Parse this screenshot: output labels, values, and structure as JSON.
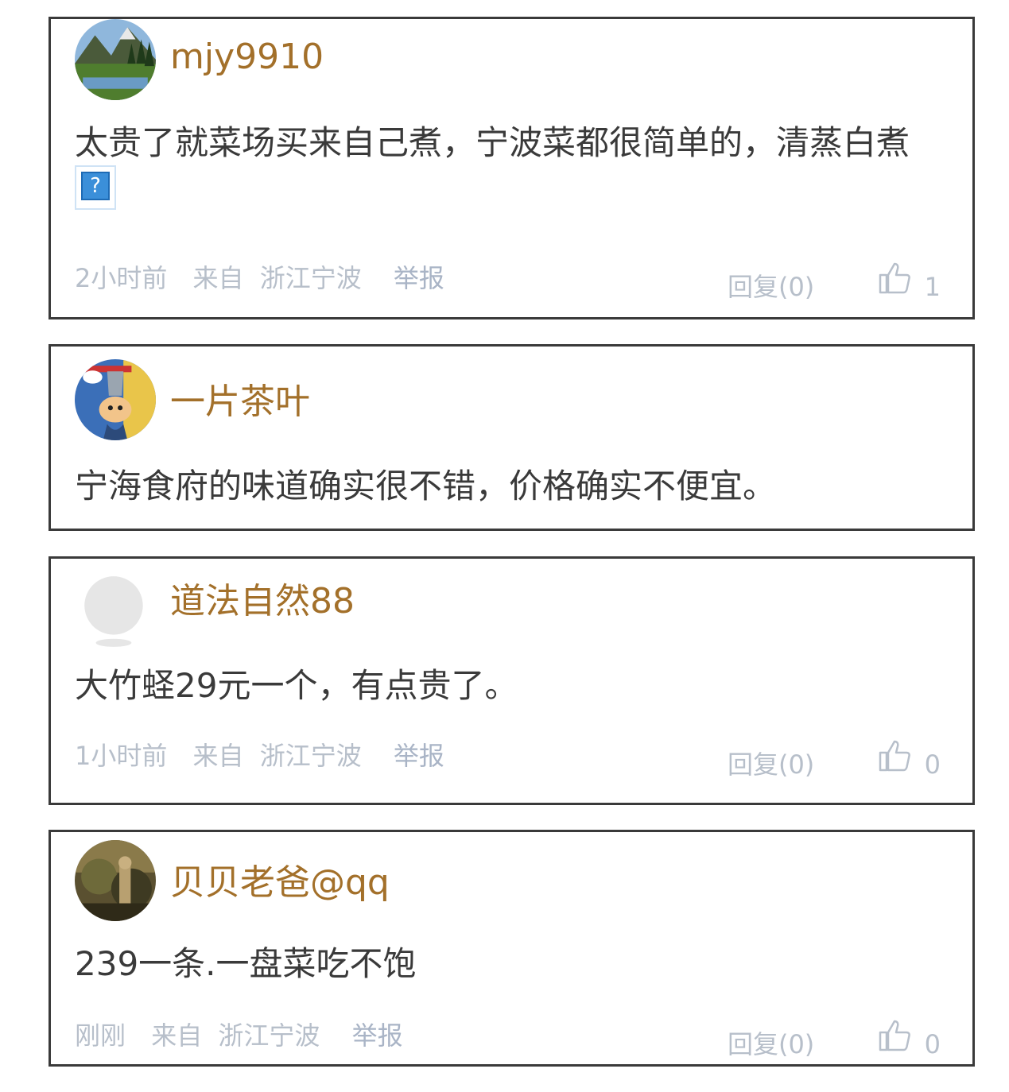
{
  "comments": [
    {
      "username": "mjy9910",
      "text": "太贵了就菜场买来自己煮，宁波菜都很简单的，清蒸白煮",
      "emoji": "?",
      "time": "2小时前",
      "from": "来自",
      "location": "浙江宁波",
      "report": "举报",
      "reply": "回复(0)",
      "likes": "1",
      "avatar": "landscape-avatar"
    },
    {
      "username": "一片茶叶",
      "text": "宁海食府的味道确实很不错，价格确实不便宜。",
      "avatar": "cartoon-avatar"
    },
    {
      "username": "道法自然88",
      "text": "大竹蛏29元一个，有点贵了。",
      "time": "1小时前",
      "from": "来自",
      "location": "浙江宁波",
      "report": "举报",
      "reply": "回复(0)",
      "likes": "0",
      "avatar": "default-avatar"
    },
    {
      "username": "贝贝老爸@qq",
      "text": "239一条.一盘菜吃不饱",
      "time": "刚刚",
      "from": "来自",
      "location": "浙江宁波",
      "report": "举报",
      "reply": "回复(0)",
      "likes": "0",
      "avatar": "photo-avatar"
    }
  ],
  "colors": {
    "username": "#a3702a",
    "text": "#3a3a3a",
    "meta": "#b7bfca",
    "border": "#3a3a3a"
  }
}
